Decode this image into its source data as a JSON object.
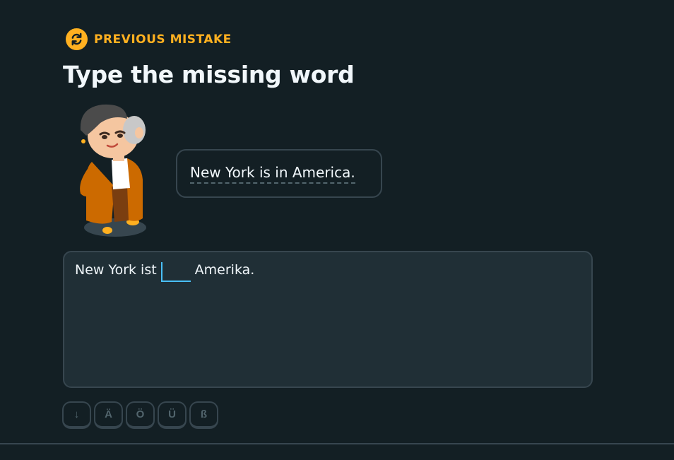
{
  "header": {
    "badge_label": "PREVIOUS MISTAKE",
    "badge_icon": "refresh-icon",
    "title": "Type the missing word"
  },
  "prompt": {
    "speech_text": "New York is in America."
  },
  "exercise": {
    "sentence_before": "New York ist",
    "blank_value": "",
    "sentence_after": "Amerika."
  },
  "keyboard": {
    "keys": [
      "↓",
      "Ä",
      "Ö",
      "Ü",
      "ß"
    ]
  },
  "colors": {
    "accent": "#ffb020",
    "background": "#131f24",
    "panel": "#202f36",
    "border": "#37464f",
    "cursor": "#49c0f8"
  }
}
